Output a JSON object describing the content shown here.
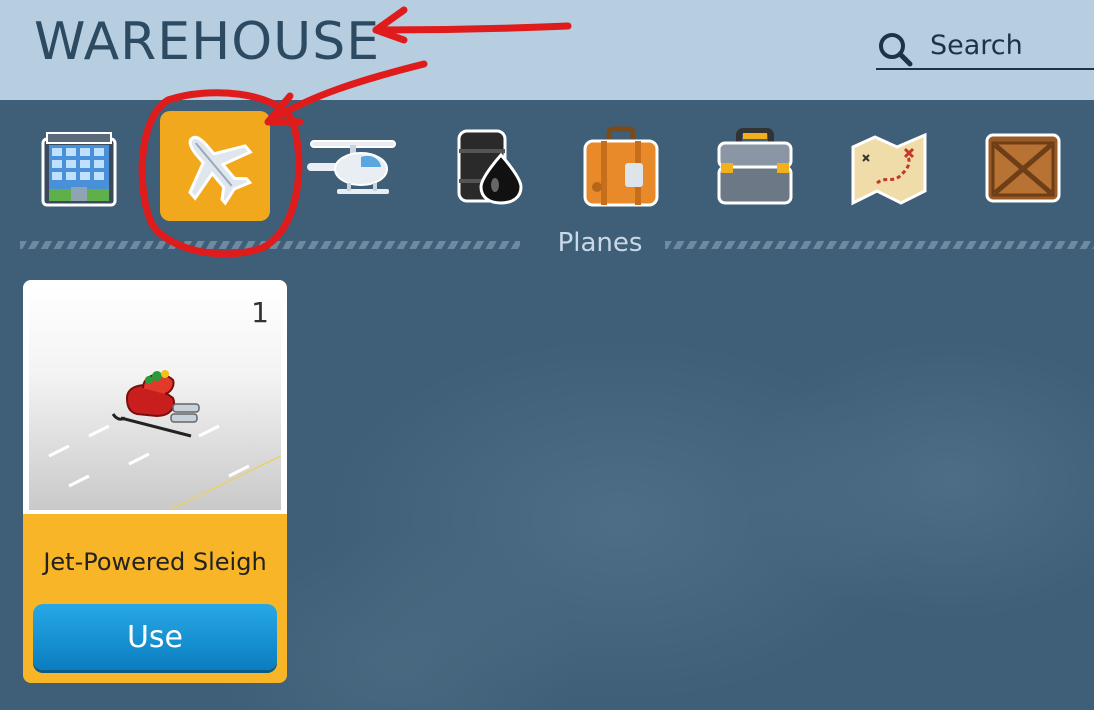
{
  "header": {
    "title": "WAREHOUSE",
    "search_placeholder": "Search"
  },
  "categories": [
    {
      "name": "Buildings",
      "icon": "building-icon"
    },
    {
      "name": "Planes",
      "icon": "plane-icon",
      "active": true
    },
    {
      "name": "Helicopters",
      "icon": "helicopter-icon"
    },
    {
      "name": "Oil",
      "icon": "oil-barrel-icon"
    },
    {
      "name": "Suitcase",
      "icon": "suitcase-icon"
    },
    {
      "name": "Toolbox",
      "icon": "toolbox-icon"
    },
    {
      "name": "Map",
      "icon": "treasure-map-icon"
    },
    {
      "name": "Crate",
      "icon": "crate-icon"
    }
  ],
  "active_category_label": "Planes",
  "items": [
    {
      "name": "Jet-Powered Sleigh",
      "count": "1",
      "action": "Use"
    }
  ],
  "colors": {
    "header_bg": "#b7cde0",
    "accent_orange": "#f2a81d",
    "use_button": "#1593d4",
    "annotation_red": "#e01b1b"
  }
}
